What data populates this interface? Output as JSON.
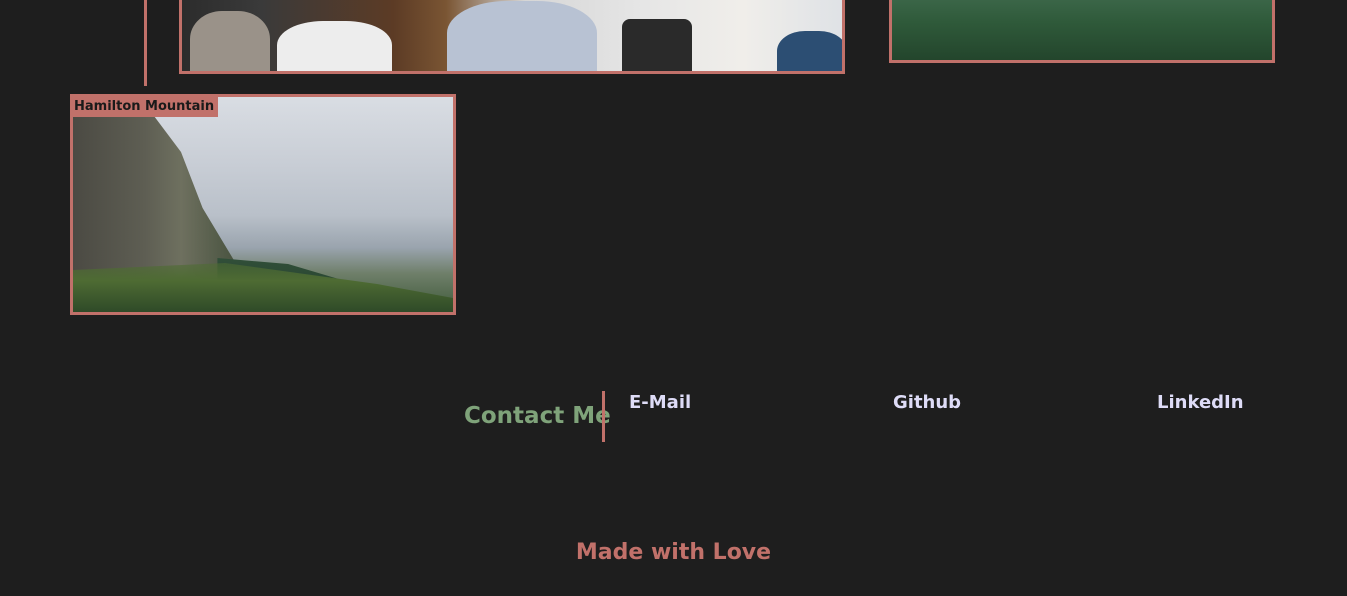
{
  "gallery": {
    "cards": [
      {
        "label": "Hamilton Mountain",
        "image_icon": "mountain-photo"
      }
    ]
  },
  "contact": {
    "title": "Contact Me",
    "links": [
      {
        "label": "E-Mail"
      },
      {
        "label": "Github"
      },
      {
        "label": "LinkedIn"
      }
    ]
  },
  "footer": {
    "text": "Made with Love"
  },
  "colors": {
    "background": "#1e1e1e",
    "accent": "#c1716a",
    "contact_title": "#7fa37a",
    "link_text": "#dedcf7"
  }
}
